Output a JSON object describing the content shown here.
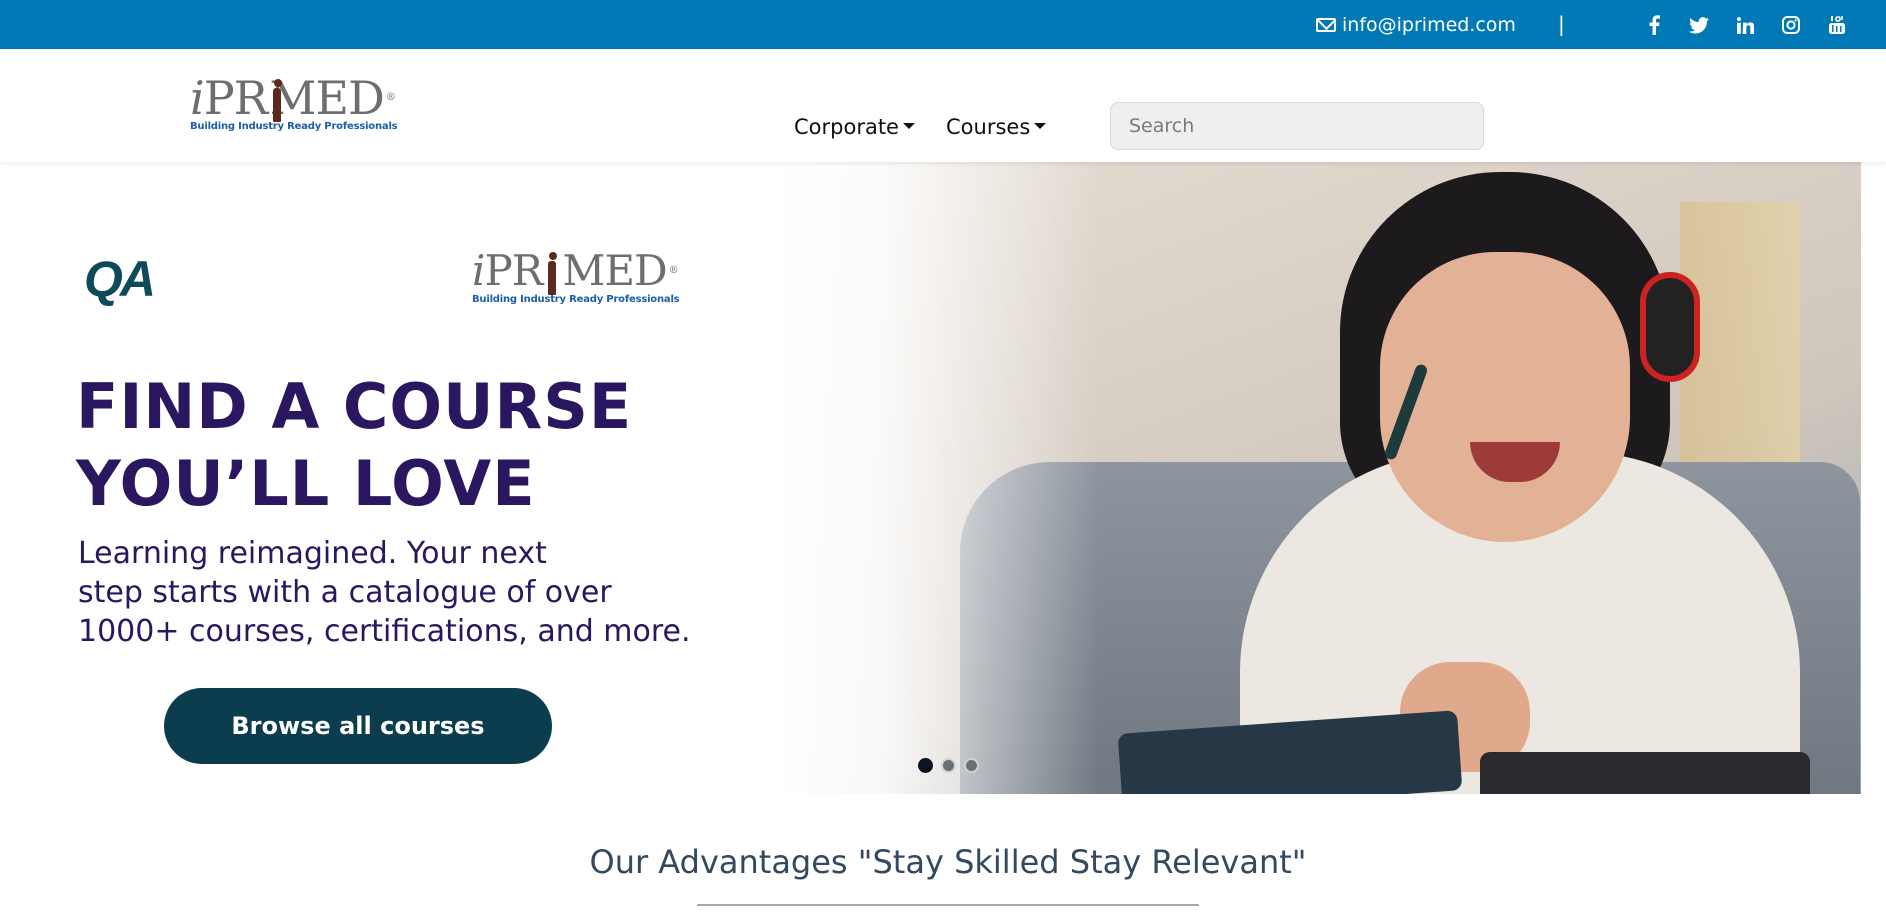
{
  "topbar": {
    "email": "info@iprimed.com",
    "separator": "|",
    "social_icons": [
      "facebook-icon",
      "twitter-icon",
      "linkedin-icon",
      "instagram-icon",
      "youtube-icon"
    ],
    "background_color": "#0079b6"
  },
  "header": {
    "logo": {
      "wordmark_left": "i",
      "wordmark_mid": "PR",
      "wordmark_right": "MED",
      "registered": "®",
      "tagline": "Building Industry Ready Professionals"
    },
    "nav": [
      {
        "label": "Corporate"
      },
      {
        "label": "Courses"
      }
    ],
    "search": {
      "placeholder": "Search"
    }
  },
  "hero": {
    "partner_logo": "QA",
    "headline": [
      "FIND A COURSE",
      "YOU’LL LOVE"
    ],
    "subtext": [
      "Learning reimagined. Your next",
      "step starts with a catalogue of over",
      "1000+ courses, certifications, and more."
    ],
    "cta_label": "Browse all courses",
    "carousel": {
      "slides": 3,
      "active_slide": 1
    },
    "colors": {
      "headline": "#2a1760",
      "cta": "#0b3d4f"
    }
  },
  "advantages": {
    "title": "Our Advantages \"Stay Skilled Stay Relevant\""
  }
}
